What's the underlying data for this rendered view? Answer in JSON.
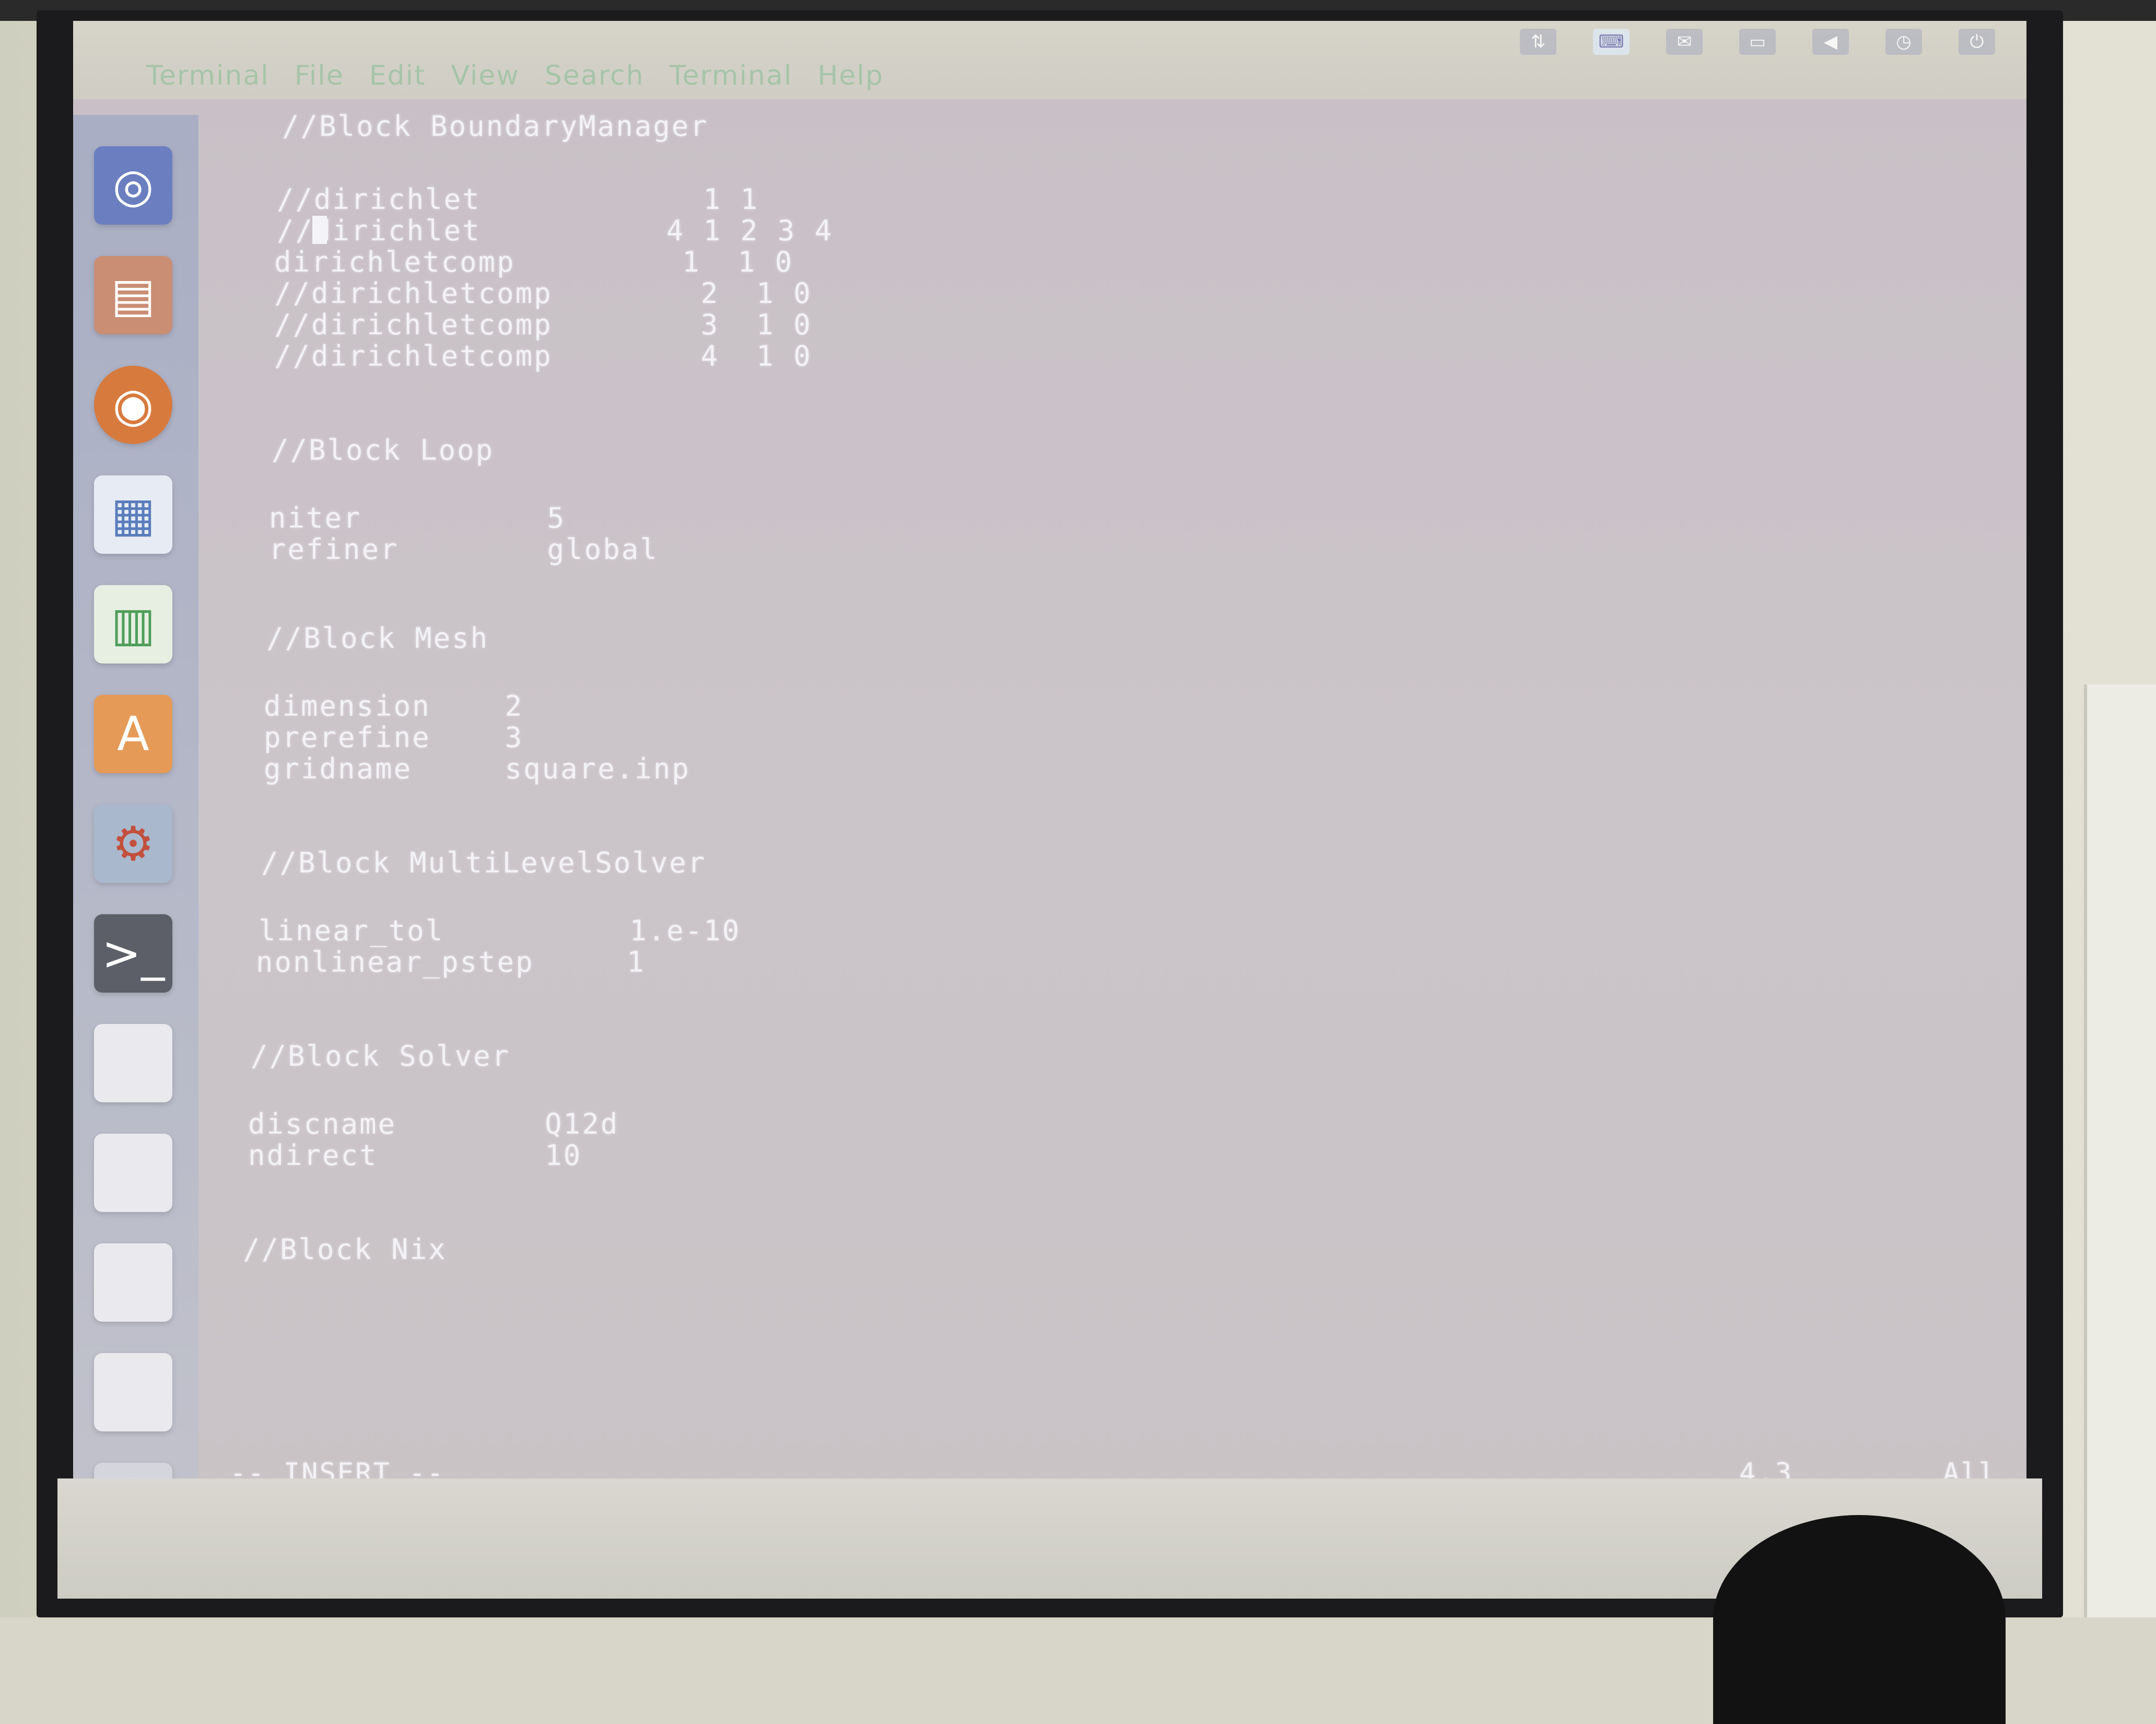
{
  "menubar": {
    "items": [
      "Terminal",
      "File",
      "Edit",
      "View",
      "Search",
      "Terminal",
      "Help"
    ]
  },
  "launcher": {
    "icons": [
      "ubuntu-dash-icon",
      "files-icon",
      "firefox-icon",
      "writer-icon",
      "calc-icon",
      "software-center-icon",
      "settings-icon",
      "terminal-icon",
      "drive-icon",
      "drive-icon",
      "drive-icon",
      "drive-icon",
      "trash-icon"
    ]
  },
  "terminal": {
    "lines": [
      "//Block BoundaryManager",
      "//dirichlet            1 1",
      "//dirichlet          4 1 2 3 4",
      "dirichletcomp         1  1 0",
      "//dirichletcomp        2  1 0",
      "//dirichletcomp        3  1 0",
      "//dirichletcomp        4  1 0",
      "//Block Loop",
      "niter          5",
      "refiner        global",
      "//Block Mesh",
      "dimension    2",
      "prerefine    3",
      "gridname     square.inp",
      "//Block MultiLevelSolver",
      "linear_tol          1.e-10",
      "nonlinear_pstep     1",
      "//Block Solver",
      "discname        Q12d",
      "ndirect         10",
      "//Block Nix"
    ],
    "status_mode": "-- INSERT --",
    "status_position": "4,3",
    "status_scroll": "All"
  }
}
